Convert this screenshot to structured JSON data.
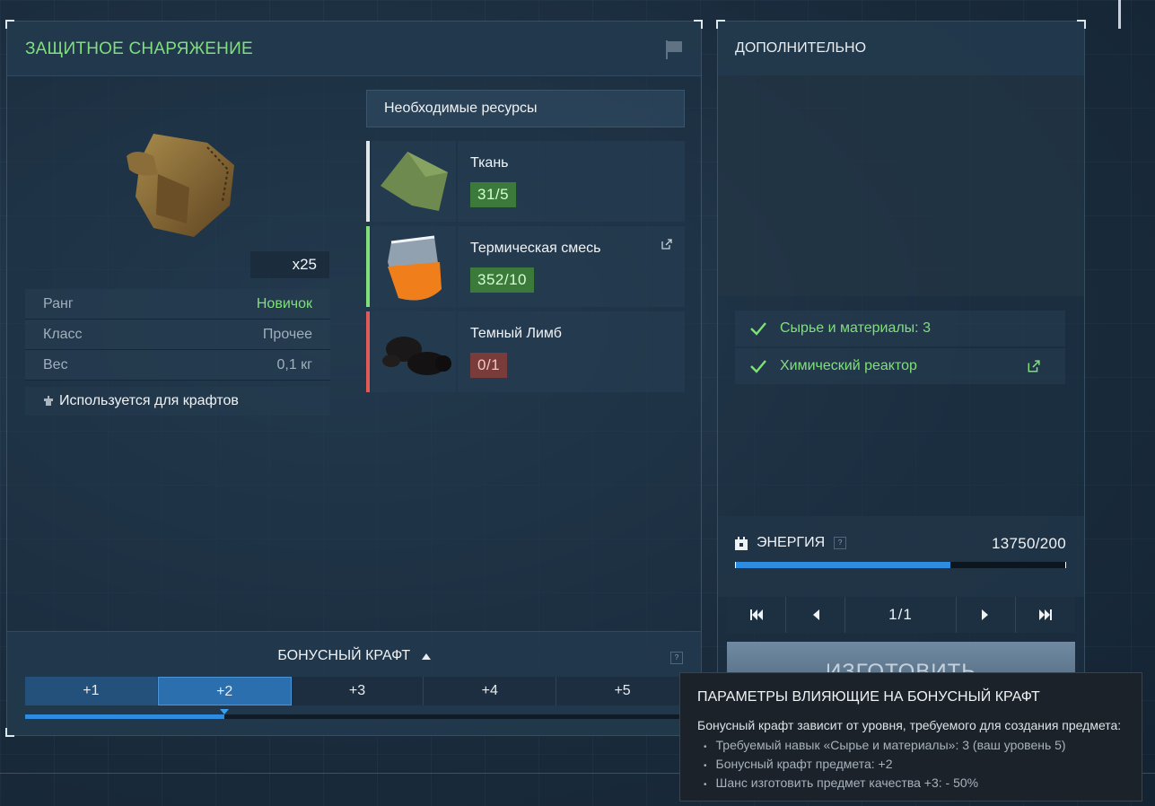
{
  "left_panel": {
    "title": "ЗАЩИТНОЕ СНАРЯЖЕНИЕ",
    "count": "x25",
    "stats": [
      {
        "label": "Ранг",
        "value": "Новичок"
      },
      {
        "label": "Класс",
        "value": "Прочее"
      },
      {
        "label": "Вес",
        "value": "0,1 кг"
      }
    ],
    "used_for": "Используется для крафтов",
    "resources_header": "Необходимые ресурсы",
    "resources": [
      {
        "name": "Ткань",
        "qty": "31/5",
        "status_color": "#e0e6ea",
        "ok": true
      },
      {
        "name": "Термическая смесь",
        "qty": "352/10",
        "status_color": "#7fe07a",
        "ok": true
      },
      {
        "name": "Темный Лимб",
        "qty": "0/1",
        "status_color": "#e05a5a",
        "ok": false
      }
    ],
    "bonus": {
      "title": "БОНУСНЫЙ КРАФТ",
      "help": "?",
      "tabs": [
        "+1",
        "+2",
        "+3",
        "+4",
        "+5"
      ],
      "active_index": 1,
      "progress_fraction": 0.3
    }
  },
  "right_panel": {
    "title": "ДОПОЛНИТЕЛЬНО",
    "requirements": [
      "Сырье и материалы: 3",
      "Химический реактор"
    ],
    "energy": {
      "label": "ЭНЕРГИЯ",
      "help": "?",
      "value": "13750/200",
      "fill_fraction": 0.65
    },
    "pager": "1/1",
    "craft_button": "ИЗГОТОВИТЬ"
  },
  "tooltip": {
    "title": "ПАРАМЕТРЫ ВЛИЯЮЩИЕ НА БОНУСНЫЙ КРАФТ",
    "subtitle": "Бонусный крафт зависит от уровня, требуемого для создания предмета:",
    "items": [
      "Требуемый навык «Сырье и материалы»: 3 (ваш уровень 5)",
      "Бонусный крафт предмета: +2",
      "Шанс изготовить предмет качества +3: - 50%"
    ]
  },
  "colors": {
    "accent_green": "#7fe07a",
    "accent_blue": "#2d8ce0",
    "accent_red": "#e05a5a"
  },
  "icons": [
    "flag-icon",
    "check-icon",
    "external-link-icon",
    "craft-icon",
    "energy-icon",
    "first-page-icon",
    "prev-page-icon",
    "next-page-icon",
    "last-page-icon",
    "triangle-up-icon"
  ]
}
